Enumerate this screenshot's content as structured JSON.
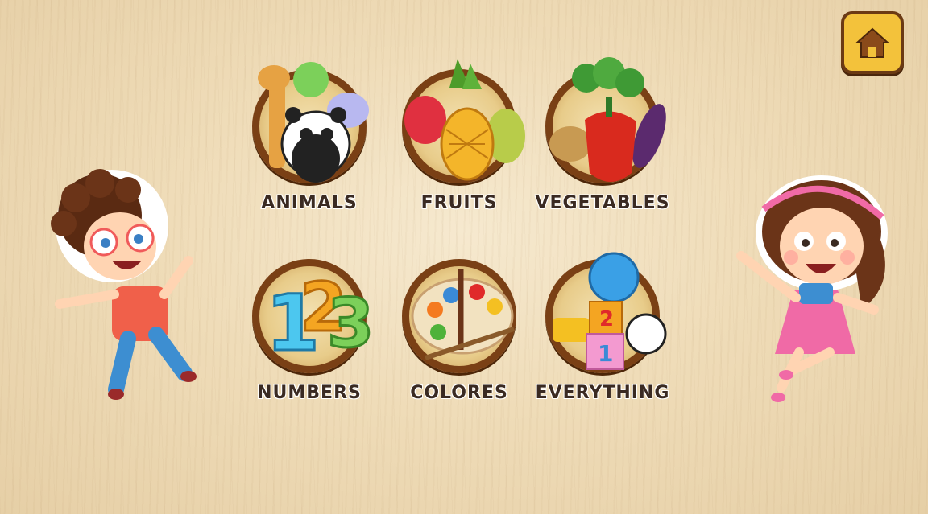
{
  "menu": {
    "categories": [
      {
        "label": "ANIMALS",
        "icon": "animals-icon"
      },
      {
        "label": "FRUITS",
        "icon": "fruits-icon"
      },
      {
        "label": "VEGETABLES",
        "icon": "vegetables-icon"
      },
      {
        "label": "NUMBERS",
        "icon": "numbers-icon"
      },
      {
        "label": "COLORES",
        "icon": "palette-icon"
      },
      {
        "label": "EVERYTHING",
        "icon": "everything-icon"
      }
    ]
  },
  "header": {
    "home_icon": "home-icon"
  },
  "colors": {
    "accent": "#f3c23b",
    "frame": "#7a4015",
    "text": "#3a2a22"
  }
}
